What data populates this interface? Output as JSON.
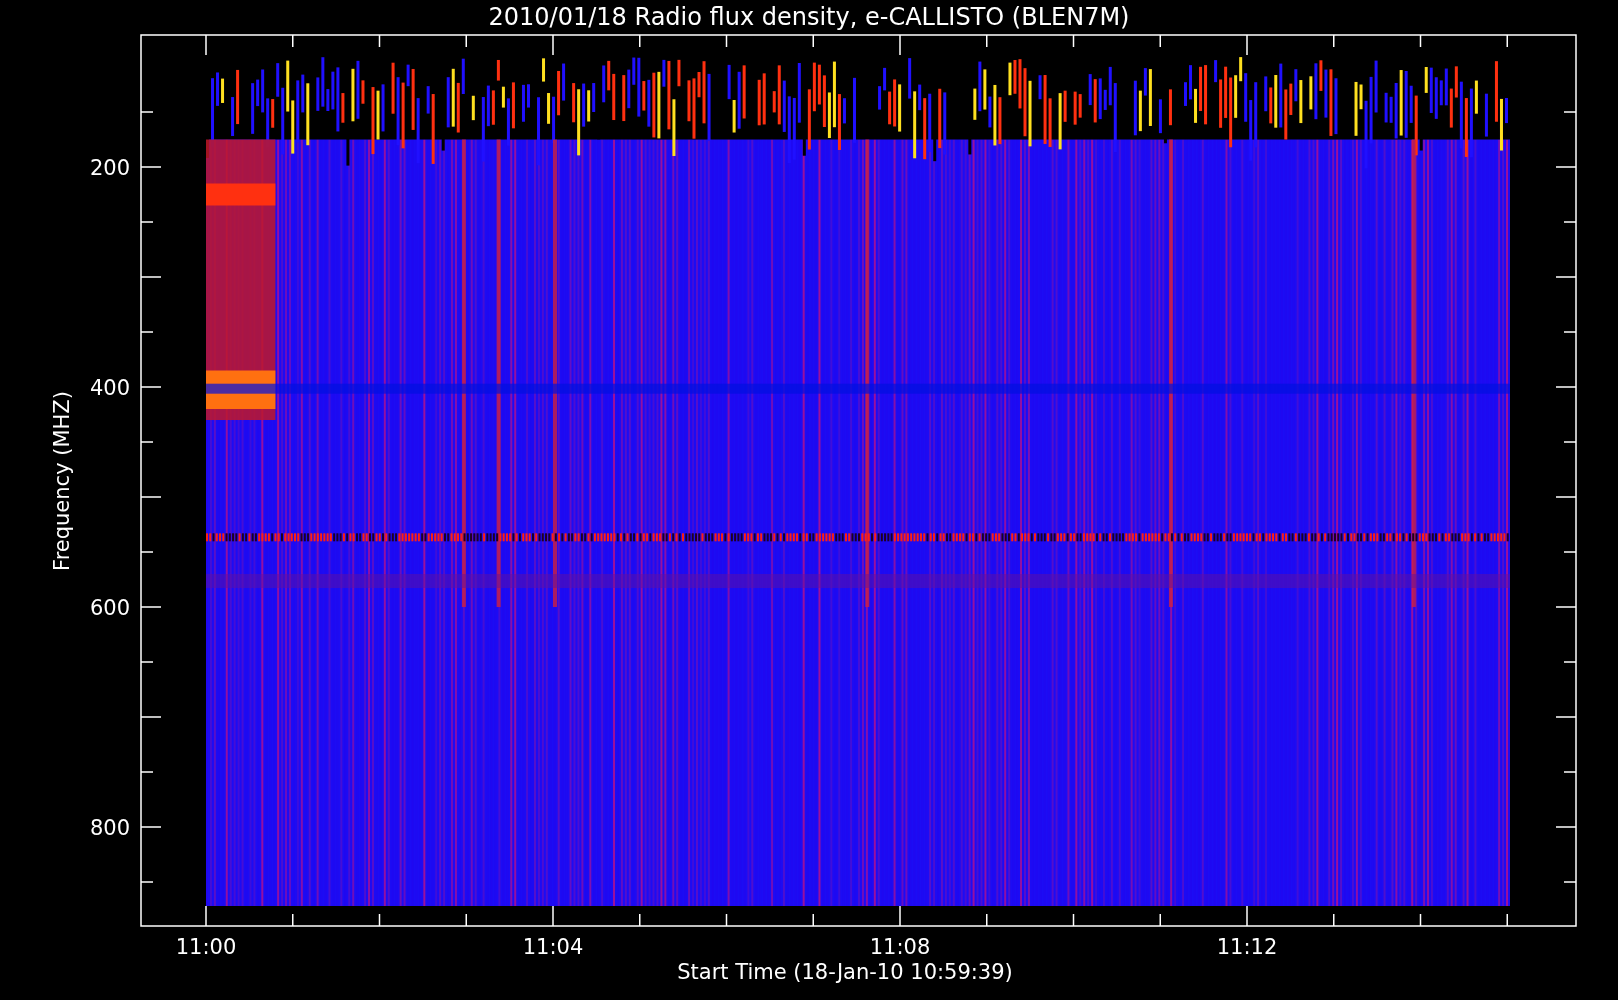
{
  "title": "2010/01/18  Radio flux density, e-CALLISTO (BLEN7M)",
  "x_axis": {
    "label": "Start Time (18-Jan-10 10:59:39)",
    "ticks": [
      "11:00",
      "11:04",
      "11:08",
      "11:12"
    ]
  },
  "y_axis": {
    "label": "Frequency (MHZ)",
    "ticks": [
      "200",
      "400",
      "600",
      "800"
    ]
  }
}
